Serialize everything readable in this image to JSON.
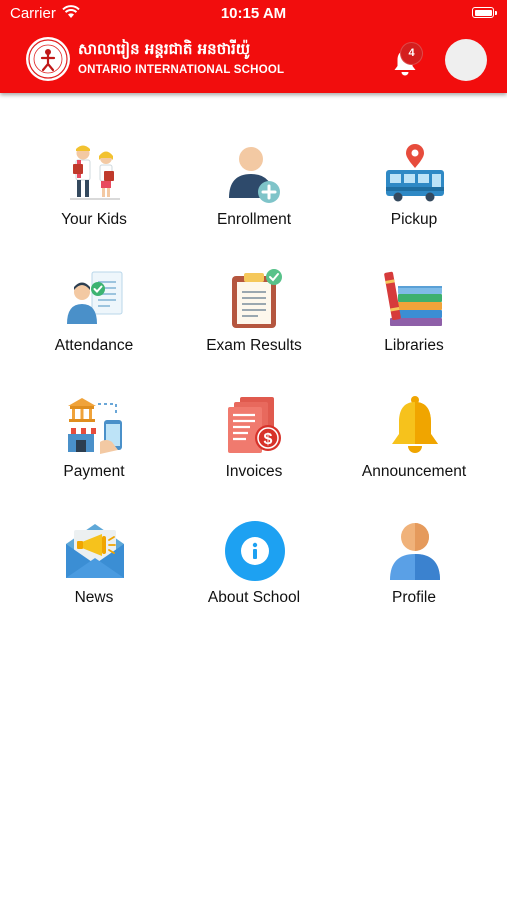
{
  "status_bar": {
    "carrier": "Carrier",
    "time": "10:15 AM"
  },
  "header": {
    "school_name_khmer": "សាលារៀន អន្តរជាតិ អនថារីយ៉ូ",
    "school_name_english": "ONTARIO INTERNATIONAL SCHOOL",
    "notification_count": "4",
    "brand_color": "#f20d0d"
  },
  "menu": {
    "rows": [
      [
        {
          "label": "Your Kids",
          "icon": "kids-icon"
        },
        {
          "label": "Enrollment",
          "icon": "enrollment-icon"
        },
        {
          "label": "Pickup",
          "icon": "bus-icon"
        }
      ],
      [
        {
          "label": "Attendance",
          "icon": "attendance-icon"
        },
        {
          "label": "Exam Results",
          "icon": "clipboard-icon"
        },
        {
          "label": "Libraries",
          "icon": "books-icon"
        }
      ],
      [
        {
          "label": "Payment",
          "icon": "payment-icon"
        },
        {
          "label": "Invoices",
          "icon": "invoice-icon"
        },
        {
          "label": "Announcement",
          "icon": "bell-icon"
        }
      ],
      [
        {
          "label": "News",
          "icon": "megaphone-icon"
        },
        {
          "label": "About School",
          "icon": "info-icon"
        },
        {
          "label": "Profile",
          "icon": "user-icon"
        }
      ]
    ]
  }
}
